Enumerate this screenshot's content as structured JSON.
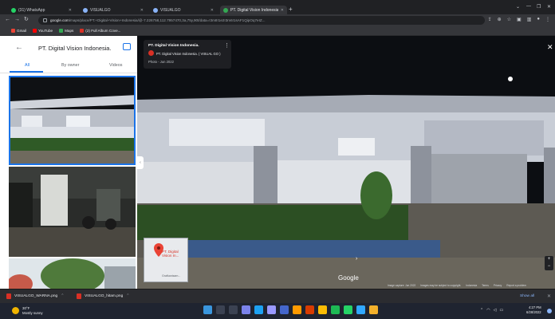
{
  "browser": {
    "tabs": [
      {
        "label": "(31) WhatsApp",
        "favicon": "whatsapp-icon",
        "active": false
      },
      {
        "label": "VISUALGO",
        "favicon": "globe-icon",
        "active": false
      },
      {
        "label": "VISUALGO",
        "favicon": "globe-icon",
        "active": false
      },
      {
        "label": "PT. Digital Vision Indonesia - Go...",
        "favicon": "maps-icon",
        "active": true
      }
    ],
    "new_tab_label": "+",
    "url_host": "google.com",
    "url_rest": "/maps/place/PT.+Digital+Vision+Indonesia/@-7.226758,112.7957470,3a,75y,90t/data=!3m8!1e2!3m6!1sAF1QipOq7eIZ...",
    "bookmarks": [
      {
        "label": "Gmail",
        "color": "#ea4335"
      },
      {
        "label": "YouTube",
        "color": "#ff0000"
      },
      {
        "label": "Maps",
        "color": "#34a853"
      },
      {
        "label": "(2) Full Album Cove...",
        "color": "#d93025"
      }
    ]
  },
  "panel": {
    "back_icon": "arrow-back-icon",
    "title": "PT. Digital Vision Indonesia.",
    "share_icon": "photo-share-icon",
    "tabs": [
      {
        "label": "All",
        "selected": true
      },
      {
        "label": "By owner",
        "selected": false
      },
      {
        "label": "Videos",
        "selected": false
      }
    ]
  },
  "photo_info": {
    "title": "PT. Digital Vision Indonesia.",
    "owner": "PT. Digital Vision Indonesia. ( VISUAL GO )",
    "date": "Photo - Jun 2022"
  },
  "minimap": {
    "label": "PT. Digital Vision In...",
    "footer": "Grafkanisam..."
  },
  "viewer": {
    "google_label": "Google",
    "status_items": [
      "Image capture: Jun 2022",
      "Images may be subject to copyright.",
      "Indonesia",
      "Terms",
      "Privacy",
      "Report a problem"
    ]
  },
  "downloads": {
    "items": [
      {
        "label": "VISUALGO_WARNA.png"
      },
      {
        "label": "VISUALGO_hitam.png"
      }
    ],
    "show_all_label": "Show all"
  },
  "taskbar": {
    "weather_temp": "30°F",
    "weather_desc": "Mostly sunny",
    "time": "4:27 PM",
    "date": "6/28/2022",
    "apps": [
      {
        "name": "windows-start-icon",
        "color": "#3a96dd"
      },
      {
        "name": "search-icon",
        "color": "#3b4252"
      },
      {
        "name": "task-view-icon",
        "color": "#3b4252"
      },
      {
        "name": "chat-icon",
        "color": "#7b83eb"
      },
      {
        "name": "edge-icon",
        "color": "#1da1f2"
      },
      {
        "name": "premiere-icon",
        "color": "#9999ff"
      },
      {
        "name": "app-icon",
        "color": "#4466cc"
      },
      {
        "name": "illustrator-icon",
        "color": "#ff9a00"
      },
      {
        "name": "app-icon",
        "color": "#d83b01"
      },
      {
        "name": "chrome-icon",
        "color": "#fbbc04"
      },
      {
        "name": "spotify-icon",
        "color": "#1db954"
      },
      {
        "name": "whatsapp-icon",
        "color": "#25d366"
      },
      {
        "name": "photoshop-icon",
        "color": "#31a8ff"
      },
      {
        "name": "app-icon",
        "color": "#f2b02b"
      }
    ]
  }
}
